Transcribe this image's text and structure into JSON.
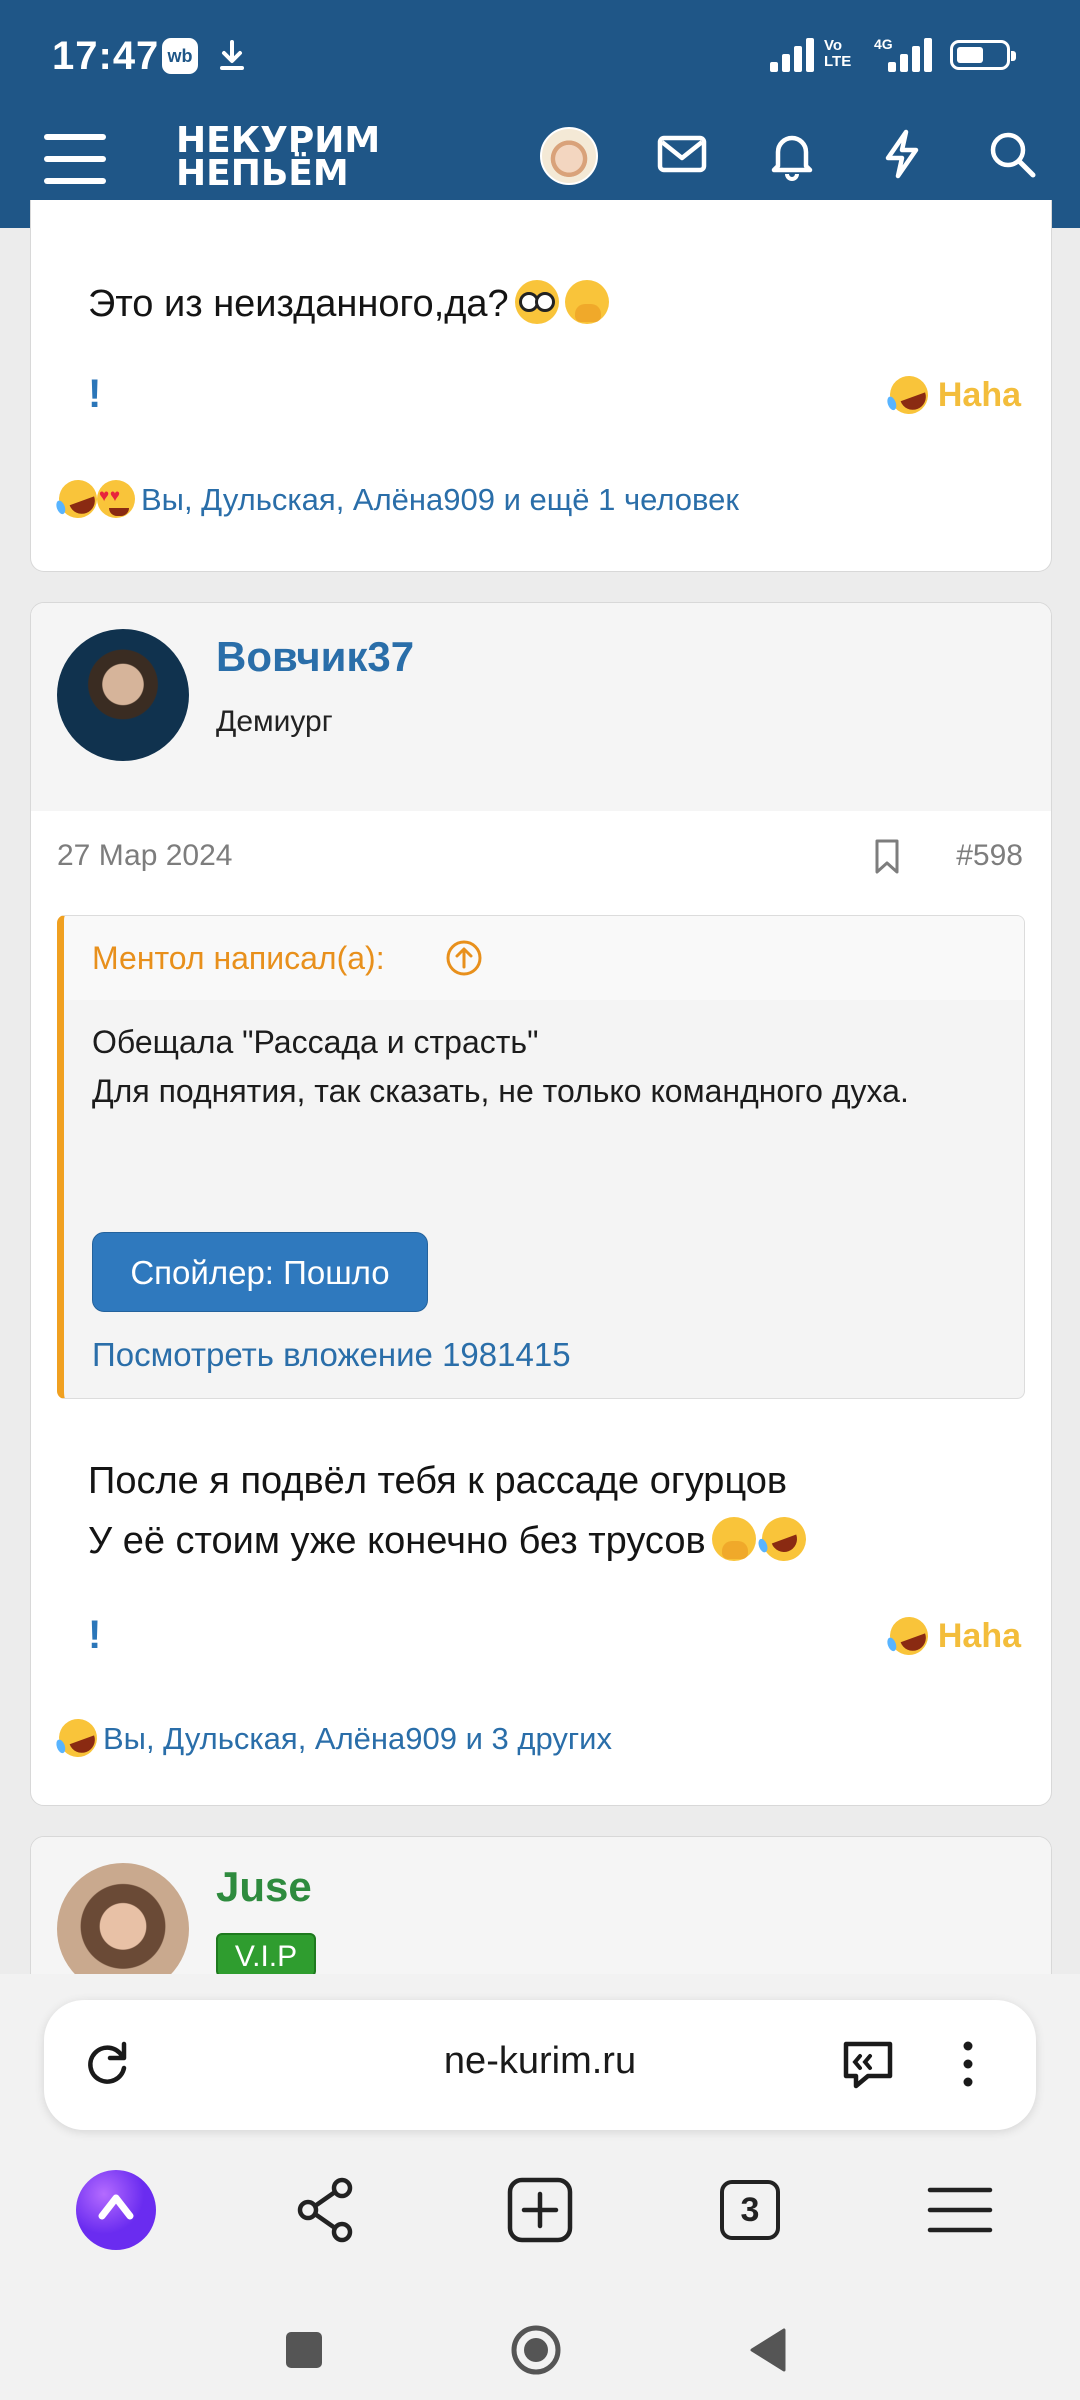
{
  "status_bar": {
    "time": "17:47",
    "wb_badge": "wb",
    "volte": "Vo LTE",
    "network": "4G"
  },
  "header": {
    "logo_line1": "НЕКУРИМ",
    "logo_line2": "НЕПЬЁМ",
    "icons": [
      "menu-icon",
      "avatar",
      "mail-icon",
      "bell-icon",
      "lightning-icon",
      "search-icon"
    ]
  },
  "post1": {
    "text": "Это из неизданного,да?",
    "report": "!",
    "reaction_label": "Haha",
    "reactors": "Вы, Дульская, Алёна909 и ещё 1 человек"
  },
  "post2": {
    "username": "Вовчик37",
    "user_title": "Демиург",
    "date": "27 Мар 2024",
    "post_number": "#598",
    "quote": {
      "author": "Ментол написал(а):",
      "body": "Обещала \"Рассада и страсть\"\nДля поднятия, так сказать, не только командного духа.",
      "spoiler_button": "Спойлер: Пошло",
      "attachment_link": "Посмотреть вложение 1981415"
    },
    "text_line1": "После я подвёл тебя к рассаде огурцов",
    "text_line2": "У её стоим уже конечно без трусов",
    "report": "!",
    "reaction_label": "Haha",
    "reactors": "Вы, Дульская, Алёна909 и 3 других"
  },
  "post3": {
    "username": "Juse",
    "badge": "V.I.P"
  },
  "browser": {
    "url": "ne-kurim.ru",
    "tab_count": "3"
  },
  "colors": {
    "header_bg": "#1f5687",
    "link_blue": "#2a6ea9",
    "quote_orange": "#e8901c",
    "haha_yellow": "#f3bd3b",
    "vip_green": "#2f9d2f",
    "juse_green": "#2e8b3e"
  }
}
